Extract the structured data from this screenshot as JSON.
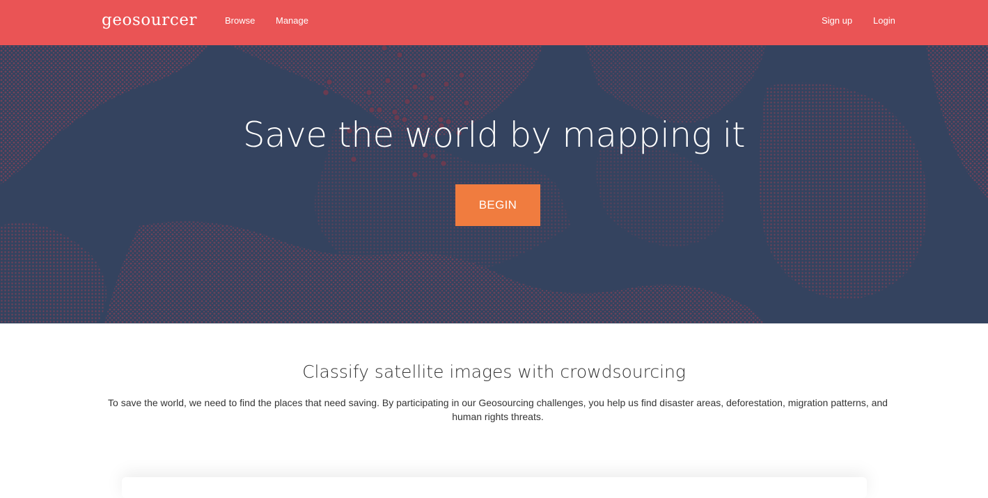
{
  "brand": {
    "name": "geosourcer"
  },
  "nav": {
    "left": [
      {
        "label": "Browse"
      },
      {
        "label": "Manage"
      }
    ],
    "right": [
      {
        "label": "Sign up"
      },
      {
        "label": "Login"
      }
    ]
  },
  "hero": {
    "title": "Save the world by mapping it",
    "button_label": "BEGIN"
  },
  "intro": {
    "title": "Classify satellite images with crowdsourcing",
    "text": "To save the world, we need to find the places that need saving. By participating in our Geosourcing challenges, you help us find disaster areas, deforestation, migration patterns, and human rights threats."
  },
  "colors": {
    "navbar": "#ea5455",
    "hero_background": "#34435f",
    "hero_pattern": "#7a4258",
    "button": "#f07c3f"
  }
}
